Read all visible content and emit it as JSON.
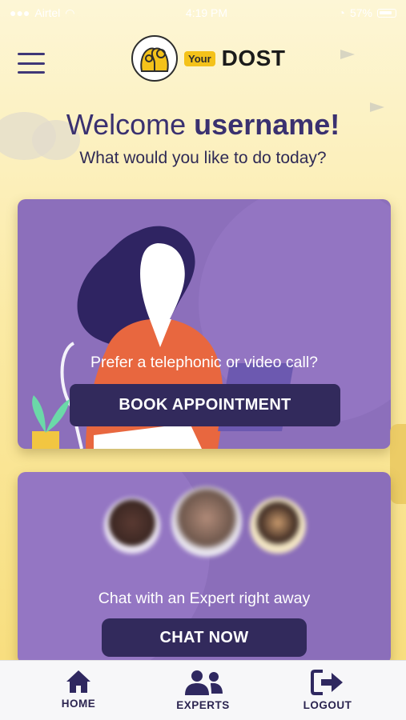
{
  "status_bar": {
    "carrier": "Airtel",
    "time": "4:19 PM",
    "battery": "57%"
  },
  "header": {
    "logo_your": "Your",
    "logo_dost": "DOST"
  },
  "welcome": {
    "prefix": "Welcome ",
    "username": "username!"
  },
  "subtitle": "What would you like to do today?",
  "cards": {
    "appointment": {
      "prompt": "Prefer a telephonic or video call?",
      "button": "BOOK APPOINTMENT"
    },
    "chat": {
      "prompt": "Chat with an Expert right away",
      "button": "CHAT NOW"
    }
  },
  "tabbar": {
    "items": [
      {
        "label": "HOME",
        "icon": "home-icon"
      },
      {
        "label": "EXPERTS",
        "icon": "experts-icon"
      },
      {
        "label": "LOGOUT",
        "icon": "logout-icon"
      }
    ]
  },
  "colors": {
    "accent": "#322a5c",
    "card": "#8c6fbb",
    "brand_yellow": "#f4c21a",
    "text": "#3a3170"
  }
}
